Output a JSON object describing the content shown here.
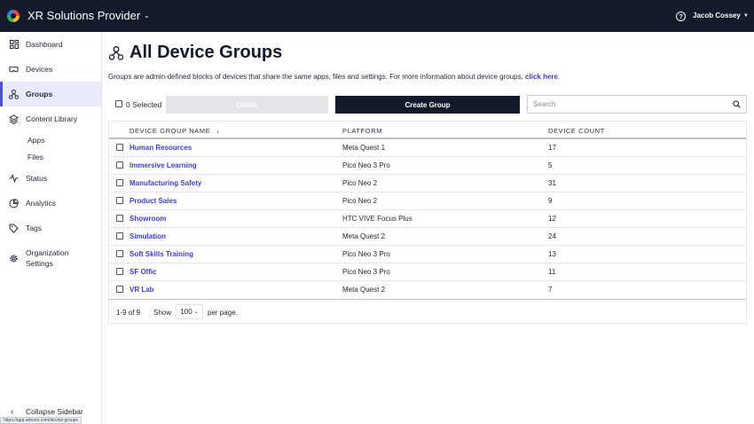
{
  "header": {
    "org_name": "XR Solutions Provider",
    "user_name": "Jacob Cossey"
  },
  "sidebar": {
    "items": [
      {
        "label": "Dashboard",
        "icon": "dashboard-icon"
      },
      {
        "label": "Devices",
        "icon": "vr-headset-icon"
      },
      {
        "label": "Groups",
        "icon": "groups-icon",
        "active": true
      },
      {
        "label": "Content Library",
        "icon": "layers-icon"
      },
      {
        "label": "Status",
        "icon": "pulse-icon"
      },
      {
        "label": "Analytics",
        "icon": "analytics-icon"
      },
      {
        "label": "Tags",
        "icon": "tag-icon"
      },
      {
        "label_line1": "Organization",
        "label_line2": "Settings",
        "icon": "gear-icon"
      }
    ],
    "sub_items": [
      "Apps",
      "Files"
    ],
    "collapse_label": "Collapse Sidebar",
    "status_url": "https://app.arborxr.com/device-groups"
  },
  "page": {
    "title": "All Device Groups",
    "description": "Groups are admin-defined blocks of devices that share the same apps, files and settings. For more information about device groups,",
    "link_text": "click here",
    "link_suffix": "."
  },
  "toolbar": {
    "selected_label": "0 Selected",
    "delete_label": "Delete",
    "create_label": "Create Group",
    "search_placeholder": "Search"
  },
  "table": {
    "columns": [
      "DEVICE GROUP NAME",
      "PLATFORM",
      "DEVICE COUNT"
    ],
    "sort_indicator": "↓",
    "rows": [
      {
        "name": "Human Resources",
        "platform": "Meta Quest 1",
        "count": "17"
      },
      {
        "name": "Immersive Learning",
        "platform": "Pico Neo 3 Pro",
        "count": "5"
      },
      {
        "name": "Manufacturing Safety",
        "platform": "Pico Neo 2",
        "count": "31"
      },
      {
        "name": "Product Sales",
        "platform": "Pico Neo 2",
        "count": "9"
      },
      {
        "name": "Showroom",
        "platform": "HTC VIVE Focus Plus",
        "count": "12"
      },
      {
        "name": "Simulation",
        "platform": "Meta Quest 2",
        "count": "24"
      },
      {
        "name": "Soft Skills Training",
        "platform": "Pico Neo 3 Pro",
        "count": "13"
      },
      {
        "name": "SF Offic",
        "platform": "Pico Neo 3 Pro",
        "count": "11"
      },
      {
        "name": "VR Lab",
        "platform": "Meta Quest 2",
        "count": "7"
      }
    ],
    "footer": {
      "range": "1-9 of 9",
      "show_label": "Show",
      "per_page_value": "100",
      "per_page_label": "per page."
    }
  },
  "colors": {
    "topbar": "#131a2b",
    "accent": "#4b4fd6",
    "link": "#3a3fc8"
  }
}
